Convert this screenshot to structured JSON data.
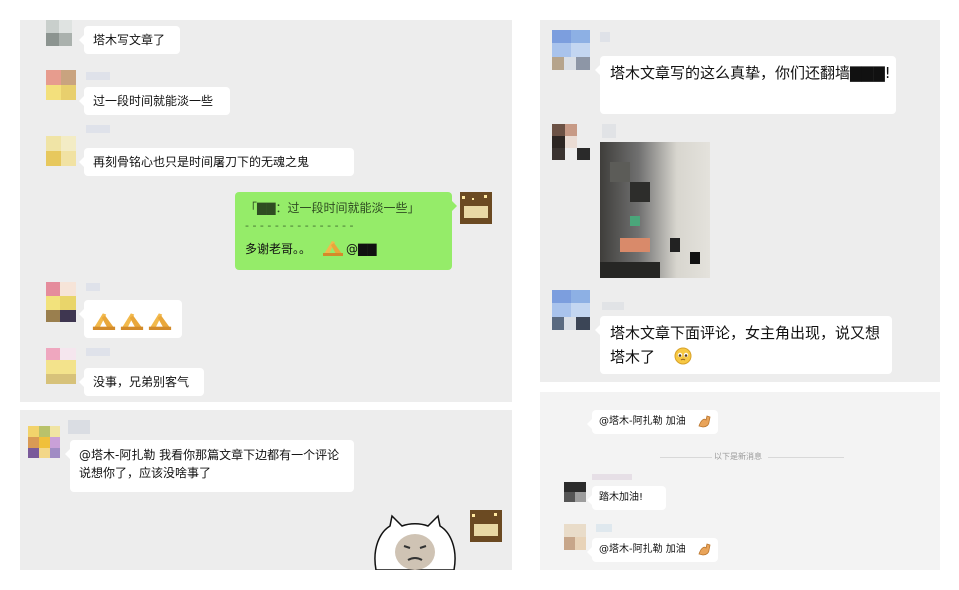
{
  "panel1": {
    "messages": [
      {
        "text": "塔木写文章了"
      },
      {
        "text": "过一段时间就能淡一些"
      },
      {
        "text": "再刻骨铭心也只是时间屠刀下的无魂之鬼"
      },
      {
        "quote": "「▇▇：过一段时间就能淡一些」",
        "divider": "- - - - - - - - - - - - - - -",
        "reply": "多谢老哥。。",
        "mention": "@▇▇"
      },
      {
        "icons": [
          "pray-hands-icon",
          "pray-hands-icon",
          "pray-hands-icon"
        ]
      },
      {
        "text": "没事，兄弟别客气"
      }
    ]
  },
  "panel2": {
    "message": {
      "text": "@塔木-阿扎勒  我看你那篇文章下边都有一个评论说想你了，应该没啥事了"
    },
    "sticker": "cat-sticker"
  },
  "panel3": {
    "messages": [
      {
        "text": "塔木文章写的这么真挚，你们还翻墙▇▇▇!"
      },
      {
        "image": "pixelated-photo"
      },
      {
        "text": "塔木文章下面评论，女主角出现，说又想塔木了"
      }
    ],
    "emoji": "pleading-face-icon"
  },
  "panel4": {
    "messages": [
      {
        "text": "@塔木-阿扎勒 加油",
        "icon": "flexed-biceps-icon"
      },
      {
        "text": "踏木加油!"
      },
      {
        "text": "@塔木-阿扎勒 加油",
        "icon": "flexed-biceps-icon"
      }
    ],
    "new_messages_label": "以下是新消息"
  },
  "colors": {
    "panel_bg": "#ededed",
    "bubble_green": "#95ec69",
    "bubble_white": "#ffffff"
  }
}
